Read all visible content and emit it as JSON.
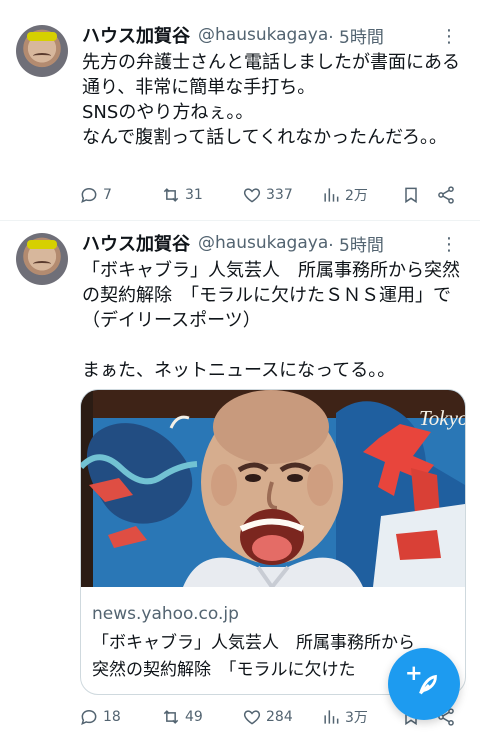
{
  "tweets": [
    {
      "name": "ハウス加賀谷",
      "handle": "@hausukagaya",
      "time": "· 5時間",
      "more": "⋮",
      "body": "先方の弁護士さんと電話しましたが書面にある通り、非常に簡単な手打ち。\nSNSのやり方ねぇ。。\nなんで腹割って話してくれなかったんだろ。。",
      "replies": "7",
      "reposts": "31",
      "likes": "337",
      "views": "2万"
    },
    {
      "name": "ハウス加賀谷",
      "handle": "@hausukagaya",
      "time": "· 5時間",
      "more": "⋮",
      "body": "「ボキャブラ」人気芸人　所属事務所から突然の契約解除　「モラルに欠けたＳＮＳ運用」で（デイリースポーツ）\n\nまぁた、ネットニュースになってる。。",
      "card": {
        "domain": "news.yahoo.co.jp",
        "title": "「ボキャブラ」人気芸人　所属事務所から\n突然の契約解除　「モラルに欠けた",
        "photo_text": "Tokyo"
      },
      "replies": "18",
      "reposts": "49",
      "likes": "284",
      "views": "3万"
    }
  ],
  "compose": {
    "label": "+"
  },
  "colors": {
    "accent": "#1d9bf0",
    "secondary_text": "#536471",
    "divider": "#eff3f4"
  },
  "icons": [
    "reply-icon",
    "repost-icon",
    "like-icon",
    "views-icon",
    "bookmark-icon",
    "share-icon",
    "more-icon",
    "compose-icon"
  ]
}
